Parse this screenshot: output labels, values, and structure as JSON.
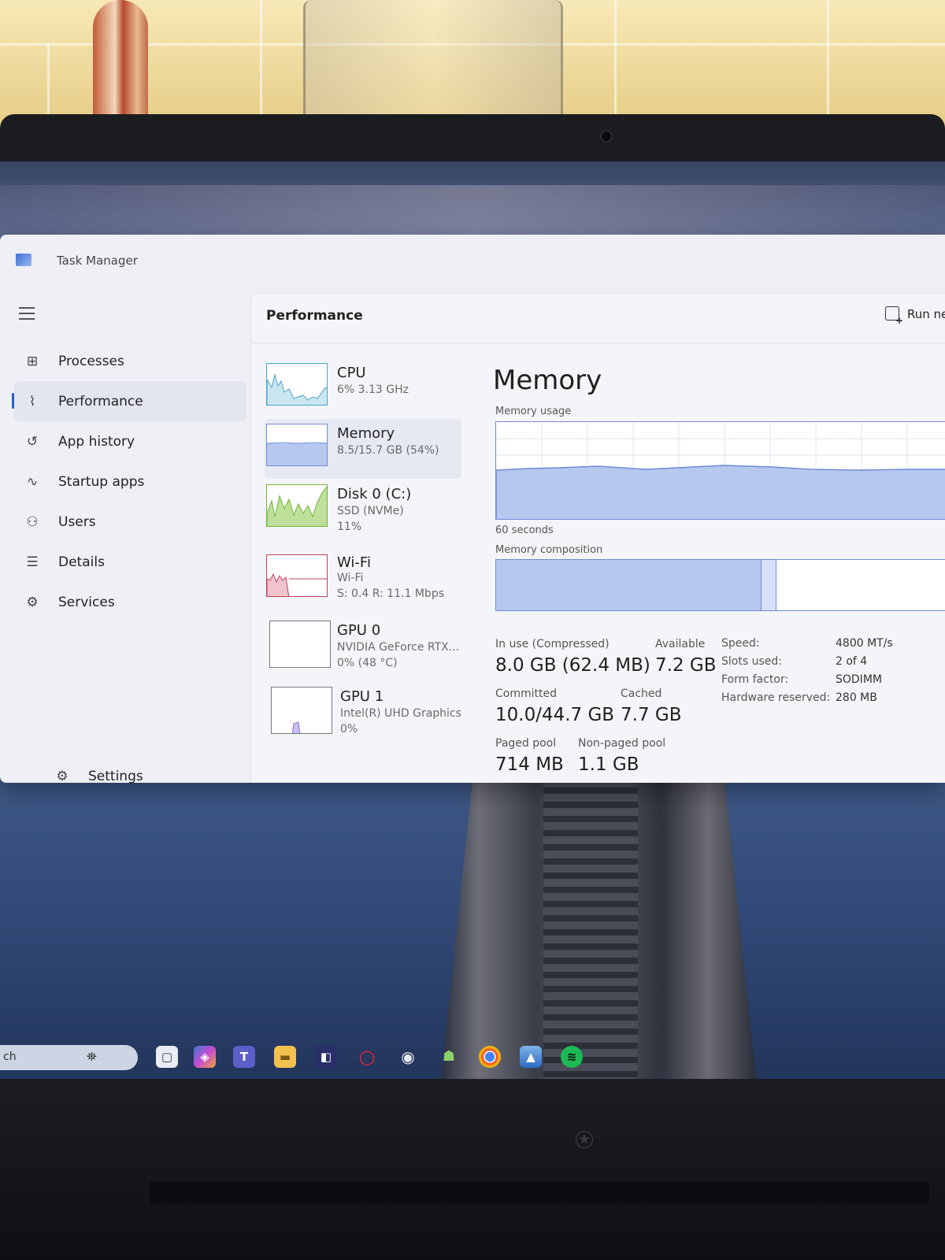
{
  "window": {
    "app_title": "Task Manager",
    "header_title": "Performance",
    "run_new_task": "Run ne"
  },
  "nav": {
    "items": [
      {
        "label": "Processes",
        "icon": "processes-icon"
      },
      {
        "label": "Performance",
        "icon": "performance-icon",
        "active": true
      },
      {
        "label": "App history",
        "icon": "app-history-icon"
      },
      {
        "label": "Startup apps",
        "icon": "startup-apps-icon"
      },
      {
        "label": "Users",
        "icon": "users-icon"
      },
      {
        "label": "Details",
        "icon": "details-icon"
      },
      {
        "label": "Services",
        "icon": "services-icon"
      }
    ],
    "settings": "Settings"
  },
  "devices": [
    {
      "name": "CPU",
      "sub1": "6% 3.13 GHz",
      "sub2": "",
      "sub3": "",
      "color": "#4aa3c7"
    },
    {
      "name": "Memory",
      "sub1": "8.5/15.7 GB (54%)",
      "sub2": "",
      "sub3": "",
      "color": "#6d8bd6",
      "selected": true
    },
    {
      "name": "Disk 0 (C:)",
      "sub1": "SSD (NVMe)",
      "sub2": "11%",
      "sub3": "",
      "color": "#6fb43a"
    },
    {
      "name": "Wi-Fi",
      "sub1": "Wi-Fi",
      "sub2": "S: 0.4 R: 11.1 Mbps",
      "sub3": "",
      "color": "#c2415a"
    },
    {
      "name": "GPU 0",
      "sub1": "NVIDIA GeForce RTX...",
      "sub2": "0% (48 °C)",
      "sub3": "",
      "color": "#8a6fd1"
    },
    {
      "name": "GPU 1",
      "sub1": "Intel(R) UHD Graphics",
      "sub2": "0%",
      "sub3": "",
      "color": "#8a6fd1"
    }
  ],
  "memory": {
    "title": "Memory",
    "usage_label": "Memory usage",
    "time_label": "60 seconds",
    "composition_label": "Memory composition",
    "usage_fraction": 0.54,
    "in_use_label": "In use (Compressed)",
    "in_use_value": "8.0 GB (62.4 MB)",
    "available_label": "Available",
    "available_value": "7.2 GB",
    "committed_label": "Committed",
    "committed_value": "10.0/44.7 GB",
    "cached_label": "Cached",
    "cached_value": "7.7 GB",
    "paged_label": "Paged pool",
    "paged_value": "714 MB",
    "nonpaged_label": "Non-paged pool",
    "nonpaged_value": "1.1 GB",
    "specs": [
      {
        "key": "Speed:",
        "value": "4800 MT/s"
      },
      {
        "key": "Slots used:",
        "value": "2 of 4"
      },
      {
        "key": "Form factor:",
        "value": "SODIMM"
      },
      {
        "key": "Hardware reserved:",
        "value": "280 MB"
      }
    ]
  },
  "taskbar": {
    "search_text": "ch",
    "icons": [
      "file-explorer-icon",
      "copilot-icon",
      "teams-icon",
      "folder-icon",
      "store-icon",
      "opera-icon",
      "steam-icon",
      "alienware-icon",
      "chrome-icon",
      "photos-icon",
      "spotify-icon"
    ]
  }
}
